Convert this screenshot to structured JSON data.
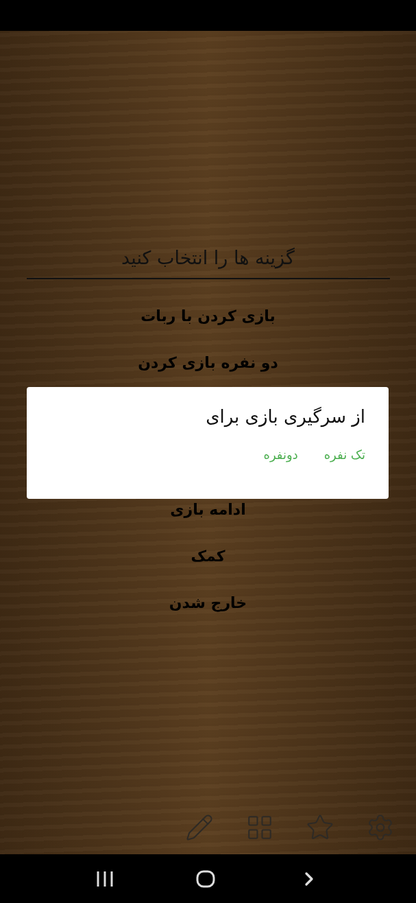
{
  "header": {
    "title": "گزینه ها را انتخاب کنید"
  },
  "menu_top": [
    {
      "label": "بازی کردن با ربات"
    },
    {
      "label": "دو نفره بازی کردن"
    }
  ],
  "menu_bottom": [
    {
      "label": "ادامه بازی"
    },
    {
      "label": "کمک"
    },
    {
      "label": "خارج شدن"
    }
  ],
  "dialog": {
    "title": "از سرگیری بازی برای",
    "buttons": [
      {
        "label": "تک نفره"
      },
      {
        "label": "دونفره"
      }
    ]
  },
  "toolbar": [
    {
      "kind": "pencil"
    },
    {
      "kind": "grid"
    },
    {
      "kind": "star"
    },
    {
      "kind": "gear"
    }
  ],
  "nav_bar": [
    {
      "kind": "recents"
    },
    {
      "kind": "home"
    },
    {
      "kind": "back"
    }
  ]
}
